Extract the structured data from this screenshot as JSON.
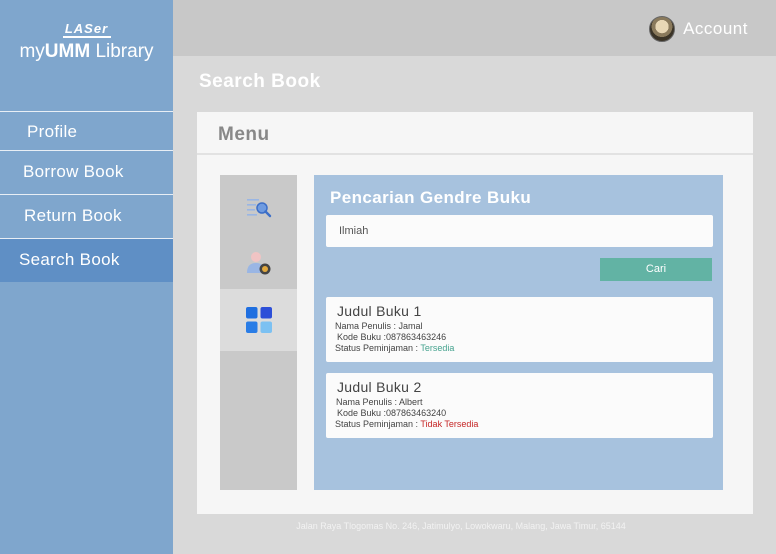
{
  "brand": {
    "mark": "LASer",
    "name_prefix": "my",
    "name_bold": "UMM",
    "name_suffix": " Library"
  },
  "sidebar": {
    "items": [
      {
        "label": "Profile"
      },
      {
        "label": "Borrow Book"
      },
      {
        "label": "Return Book"
      },
      {
        "label": "Search Book"
      }
    ]
  },
  "header": {
    "account_label": "Account"
  },
  "page": {
    "title": "Search Book"
  },
  "card": {
    "title": "Menu"
  },
  "rail": {
    "items": [
      {
        "icon": "search-list-icon"
      },
      {
        "icon": "user-settings-icon"
      },
      {
        "icon": "grid-icon"
      }
    ]
  },
  "search": {
    "title": "Pencarian Gendre Buku",
    "input_value": "Ilmiah",
    "button_label": "Cari"
  },
  "books": [
    {
      "title": "Judul Buku 1",
      "author_label": "Nama Penulis : Jamal",
      "code_label": "Kode Buku :087863463246",
      "status_label": "Status Peminjaman : ",
      "status_value": "Tersedia"
    },
    {
      "title": "Judul Buku 2",
      "author_label": "Nama Penulis : Albert",
      "code_label": "Kode Buku :087863463240",
      "status_label": "Status Peminjaman : ",
      "status_value": "Tidak Tersedia"
    }
  ],
  "footer": {
    "address": "Jalan Raya Tlogomas No. 246, Jatimulyo, Lowokwaru, Malang, Jawa Timur, 65144"
  },
  "colors": {
    "sidebar": "#7fa6cd",
    "sidebar_active": "#5f8fc5",
    "panel": "#a7c2de",
    "button": "#62b3a4",
    "available": "#46a38f",
    "unavailable": "#c62626"
  }
}
